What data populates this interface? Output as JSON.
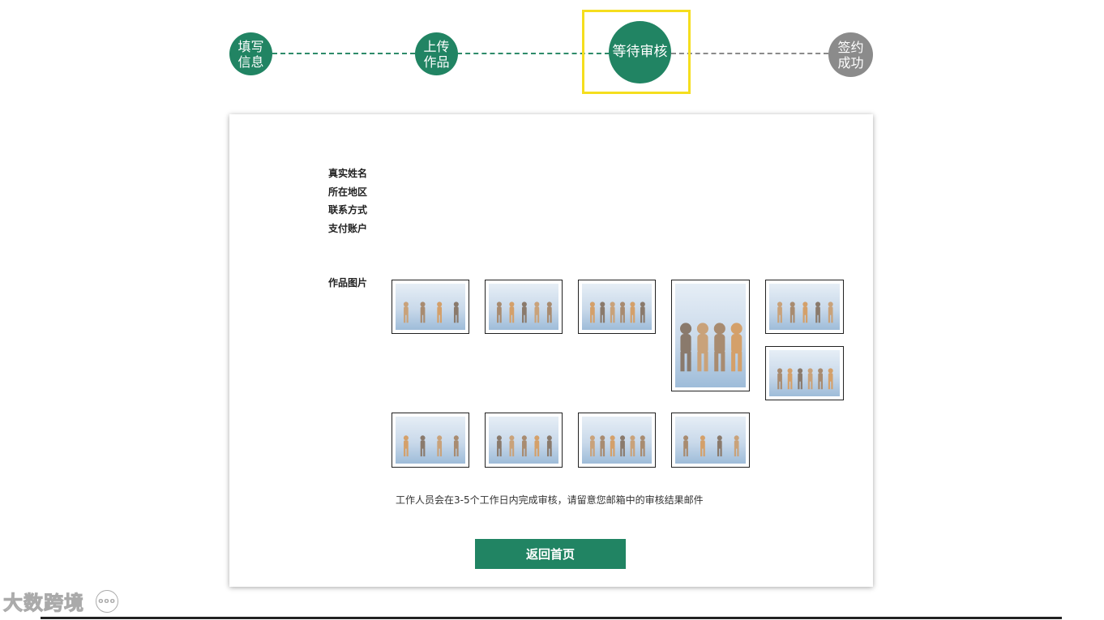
{
  "steps": [
    {
      "label": "填写\n信息",
      "state": "done"
    },
    {
      "label": "上传\n作品",
      "state": "done"
    },
    {
      "label": "等待审核",
      "state": "current"
    },
    {
      "label": "签约\n成功",
      "state": "pending"
    }
  ],
  "fields": {
    "real_name": "真实姓名",
    "region": "所在地区",
    "contact": "联系方式",
    "payment_account": "支付账户",
    "work_images": "作品图片"
  },
  "note": "工作人员会在3-5个工作日内完成审核，请留意您邮箱中的审核结果邮件",
  "back_button": "返回首页",
  "watermark": "大数跨境",
  "watermark_dots": "ooo",
  "colors": {
    "accent": "#218463",
    "pending": "#8b8b8b",
    "highlight": "#f5de1e"
  }
}
